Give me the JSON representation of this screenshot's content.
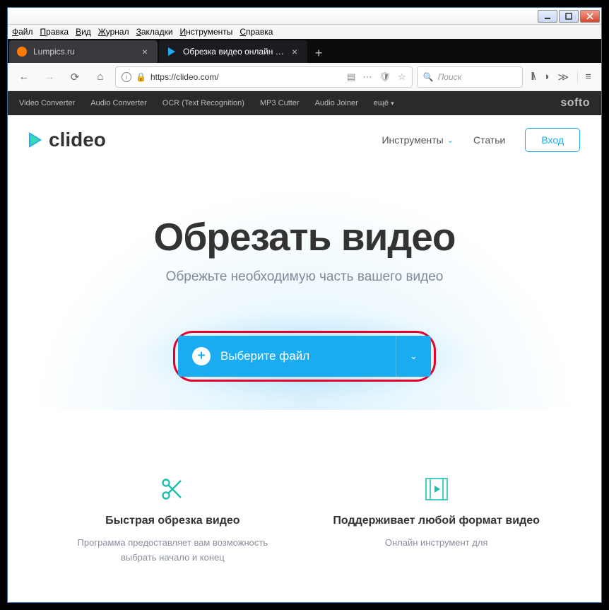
{
  "menubar": [
    "Файл",
    "Правка",
    "Вид",
    "Журнал",
    "Закладки",
    "Инструменты",
    "Справка"
  ],
  "tabs": [
    {
      "title": "Lumpics.ru"
    },
    {
      "title": "Обрезка видео онлайн — Обр"
    }
  ],
  "nav": {
    "url": "https://clideo.com/",
    "search_placeholder": "Поиск"
  },
  "softobar": {
    "items": [
      "Video Converter",
      "Audio Converter",
      "OCR (Text Recognition)",
      "MP3 Cutter",
      "Audio Joiner"
    ],
    "more": "ещё",
    "brand": "softo"
  },
  "site": {
    "logo": "clideo",
    "nav": {
      "tools": "Инструменты",
      "articles": "Статьи",
      "login": "Вход"
    }
  },
  "hero": {
    "title": "Обрезать видео",
    "subtitle": "Обрежьте необходимую часть вашего видео",
    "file_button": "Выберите файл"
  },
  "features": [
    {
      "title": "Быстрая обрезка видео",
      "text": "Программа предоставляет вам возможность выбрать начало и конец"
    },
    {
      "title": "Поддерживает любой формат видео",
      "text": "Онлайн инструмент для"
    }
  ]
}
